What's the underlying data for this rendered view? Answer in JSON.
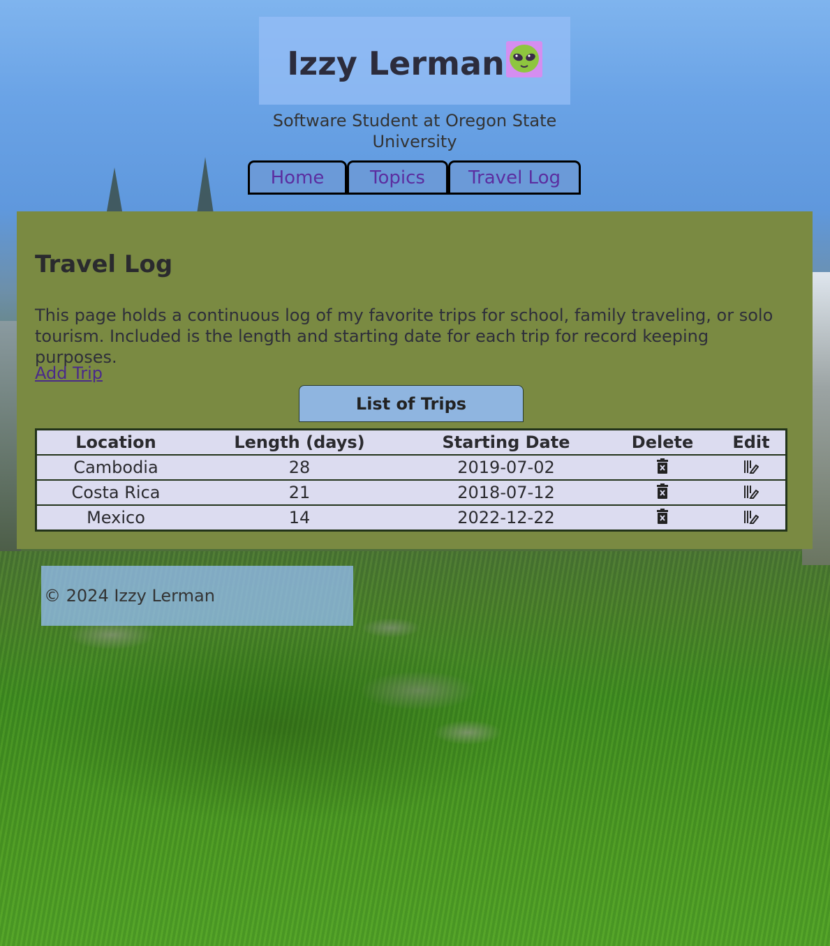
{
  "header": {
    "title": "Izzy Lerman",
    "title_emoji_icon": "alien-emoji-icon",
    "subtitle": "Software Student at Oregon State University"
  },
  "nav": {
    "items": [
      {
        "label": "Home"
      },
      {
        "label": "Topics"
      },
      {
        "label": "Travel Log"
      }
    ]
  },
  "main": {
    "heading": "Travel Log",
    "intro": "This page holds a continuous log of my favorite trips for school, family traveling, or solo tourism. Included is the length and starting date for each trip for record keeping purposes.",
    "add_link": "Add Trip",
    "table": {
      "caption": "List of Trips",
      "headers": [
        "Location",
        "Length (days)",
        "Starting Date",
        "Delete",
        "Edit"
      ],
      "rows": [
        {
          "location": "Cambodia",
          "length": "28",
          "date": "2019-07-02"
        },
        {
          "location": "Costa Rica",
          "length": "21",
          "date": "2018-07-12"
        },
        {
          "location": "Mexico",
          "length": "14",
          "date": "2022-12-22"
        }
      ],
      "delete_icon": "trash-icon",
      "edit_icon": "edit-icon"
    }
  },
  "footer": {
    "copyright": "© 2024 Izzy Lerman"
  },
  "colors": {
    "content_bg": "#7a8a42",
    "nav_bg": "#6b9ad8",
    "link": "#5b2ea0",
    "table_bg": "#dcdcf0",
    "caption_bg": "#8fb5e0"
  }
}
